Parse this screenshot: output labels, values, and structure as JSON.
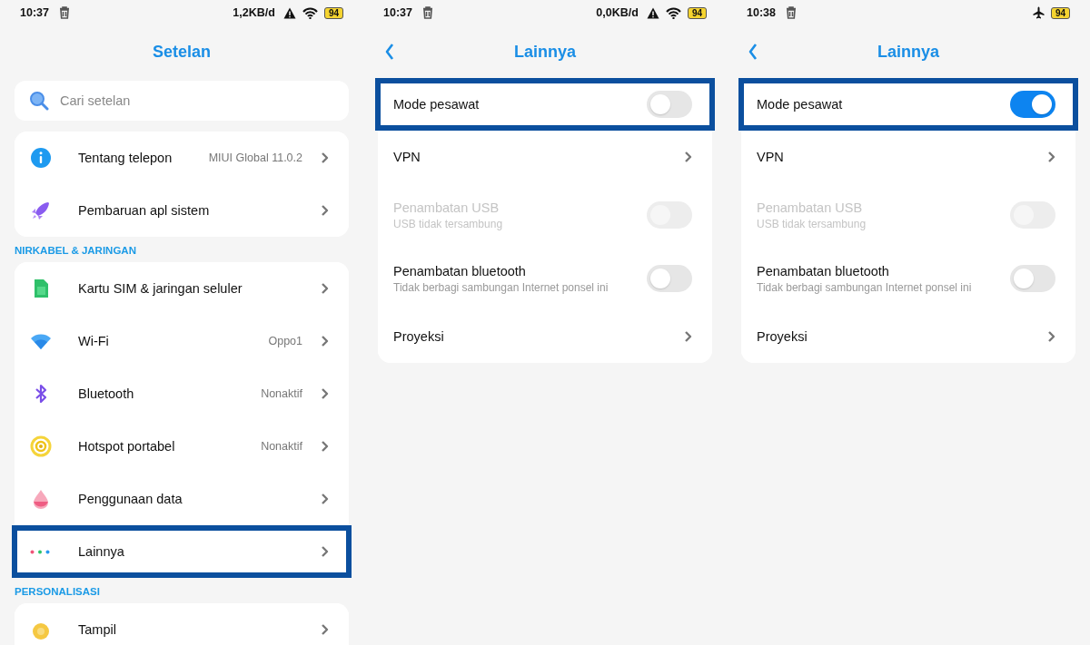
{
  "screens": [
    {
      "kind": "main",
      "status_bar": {
        "time": "10:37",
        "speed": "1,2KB/d",
        "warning": true,
        "wifi": true,
        "airplane": false,
        "battery": "94"
      },
      "back_button": false,
      "title": "Setelan",
      "search": {
        "placeholder": "Cari setelan"
      },
      "groups": [
        {
          "items": [
            {
              "kind": "link",
              "label": "Tentang telepon",
              "value": "MIUI Global 11.0.2",
              "highlighted": false
            },
            {
              "kind": "link",
              "label": "Pembaruan apl sistem",
              "highlighted": false
            }
          ]
        },
        {
          "header": "NIRKABEL & JARINGAN",
          "items": [
            {
              "kind": "link",
              "label": "Kartu SIM & jaringan seluler",
              "highlighted": false
            },
            {
              "kind": "link",
              "label": "Wi-Fi",
              "value": "Oppo1",
              "highlighted": false
            },
            {
              "kind": "link",
              "label": "Bluetooth",
              "value": "Nonaktif",
              "highlighted": false
            },
            {
              "kind": "link",
              "label": "Hotspot portabel",
              "value": "Nonaktif",
              "highlighted": false
            },
            {
              "kind": "link",
              "label": "Penggunaan data",
              "highlighted": false
            },
            {
              "kind": "link",
              "label": "Lainnya",
              "highlighted": true
            }
          ]
        },
        {
          "header": "PERSONALISASI",
          "items": [
            {
              "kind": "link",
              "label": "Tampil",
              "highlighted": false
            }
          ]
        }
      ]
    },
    {
      "kind": "sub",
      "status_bar": {
        "time": "10:37",
        "speed": "0,0KB/d",
        "warning": true,
        "wifi": true,
        "airplane": false,
        "battery": "94"
      },
      "back_button": true,
      "title": "Lainnya",
      "groups": [
        {
          "items": [
            {
              "kind": "toggle",
              "label": "Mode pesawat",
              "on": false,
              "disabled": false,
              "highlighted": true
            },
            {
              "kind": "link",
              "label": "VPN",
              "highlighted": false
            },
            {
              "kind": "toggle",
              "label": "Penambatan USB",
              "subtitle": "USB tidak tersambung",
              "on": false,
              "disabled": true,
              "highlighted": false
            },
            {
              "kind": "toggle",
              "label": "Penambatan bluetooth",
              "subtitle": "Tidak berbagi sambungan Internet ponsel ini",
              "on": false,
              "disabled": false,
              "highlighted": false
            },
            {
              "kind": "link",
              "label": "Proyeksi",
              "highlighted": false
            }
          ]
        }
      ]
    },
    {
      "kind": "sub",
      "status_bar": {
        "time": "10:38",
        "warning": false,
        "wifi": false,
        "airplane": true,
        "battery": "94"
      },
      "back_button": true,
      "title": "Lainnya",
      "groups": [
        {
          "items": [
            {
              "kind": "toggle",
              "label": "Mode pesawat",
              "on": true,
              "disabled": false,
              "highlighted": true
            },
            {
              "kind": "link",
              "label": "VPN",
              "highlighted": false
            },
            {
              "kind": "toggle",
              "label": "Penambatan USB",
              "subtitle": "USB tidak tersambung",
              "on": false,
              "disabled": true,
              "highlighted": false
            },
            {
              "kind": "toggle",
              "label": "Penambatan bluetooth",
              "subtitle": "Tidak berbagi sambungan Internet ponsel ini",
              "on": false,
              "disabled": false,
              "highlighted": false
            },
            {
              "kind": "link",
              "label": "Proyeksi",
              "highlighted": false
            }
          ]
        }
      ]
    }
  ]
}
